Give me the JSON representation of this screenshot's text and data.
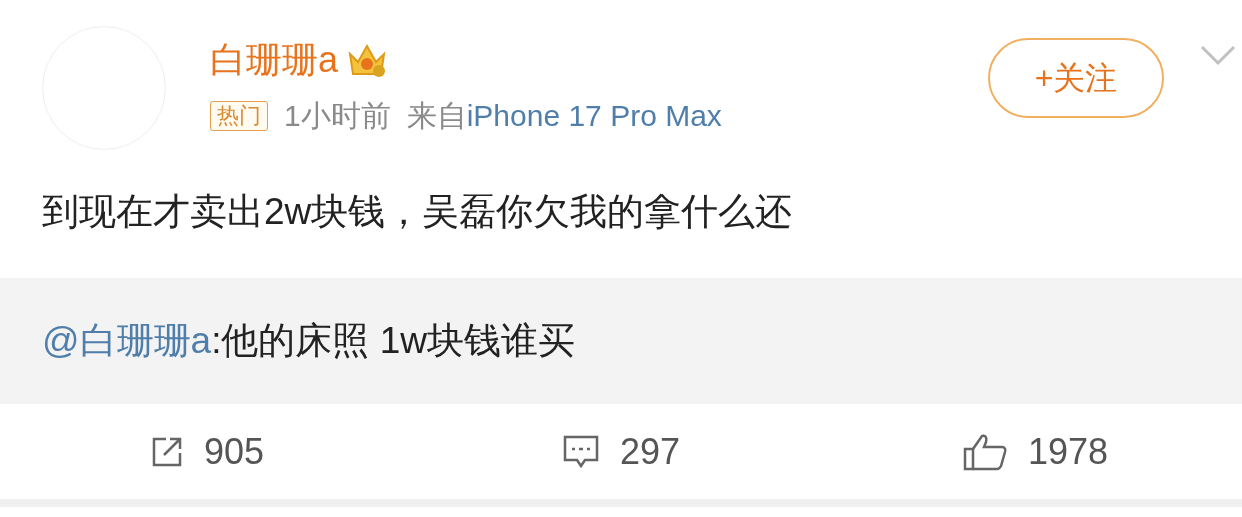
{
  "post": {
    "user": {
      "name": "白珊珊a"
    },
    "follow_button": "+关注",
    "tag": "热门",
    "time": "1小时前",
    "source_prefix": "来自",
    "source": "iPhone 17 Pro Max",
    "text": "到现在才卖出2w块钱，吴磊你欠我的拿什么还"
  },
  "quoted": {
    "mention": "@白珊珊a",
    "text": ":他的床照 1w块钱谁买"
  },
  "actions": [
    {
      "kind": "repost",
      "count": "905"
    },
    {
      "kind": "comment",
      "count": "297"
    },
    {
      "kind": "like",
      "count": "1978"
    }
  ]
}
